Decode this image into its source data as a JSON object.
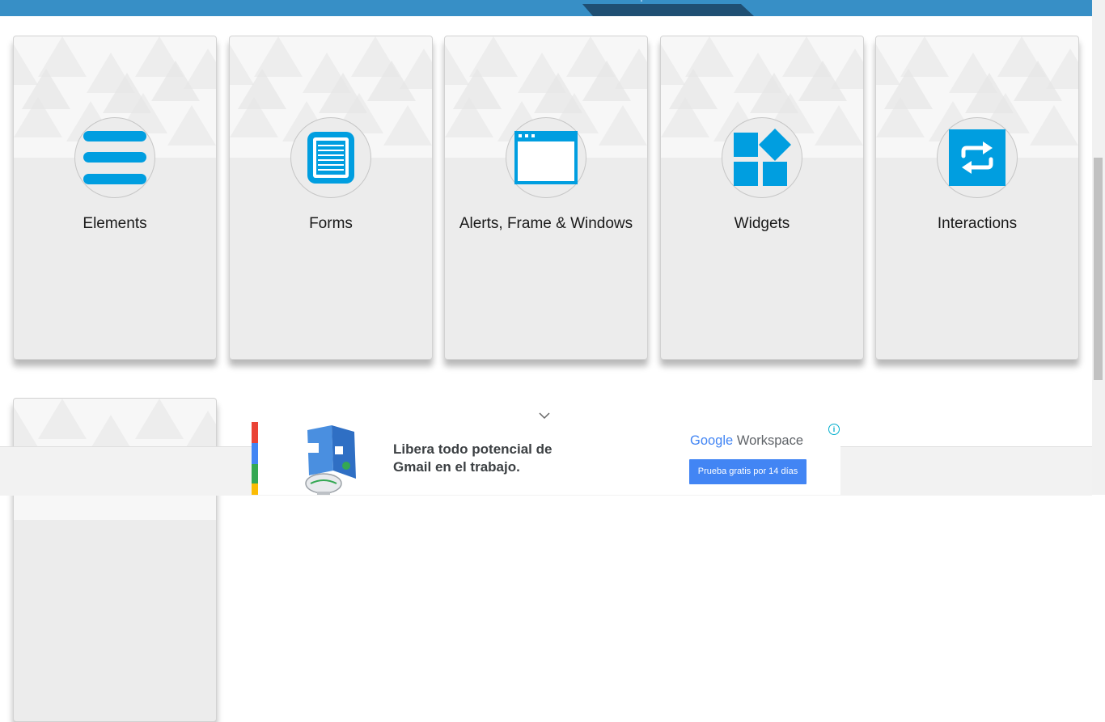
{
  "cards": [
    {
      "title": "Elements",
      "icon": "list-icon"
    },
    {
      "title": "Forms",
      "icon": "document-icon"
    },
    {
      "title": "Alerts, Frame & Windows",
      "icon": "browser-window-icon"
    },
    {
      "title": "Widgets",
      "icon": "widgets-icon"
    },
    {
      "title": "Interactions",
      "icon": "sync-arrows-icon"
    }
  ],
  "ad": {
    "headline": "Libera todo potencial de Gmail en el trabajo.",
    "brand_google": "Google",
    "brand_product": "Workspace",
    "cta": "Prueba gratis por 14 días",
    "info_glyph": "i",
    "collapse_icon": "chevron-down-icon"
  },
  "colors": {
    "header": "#378fc6",
    "header_tab": "#1f4f73",
    "icon_blue": "#009ee0",
    "card_bg": "#ececec",
    "ad_cta": "#4285f4"
  }
}
